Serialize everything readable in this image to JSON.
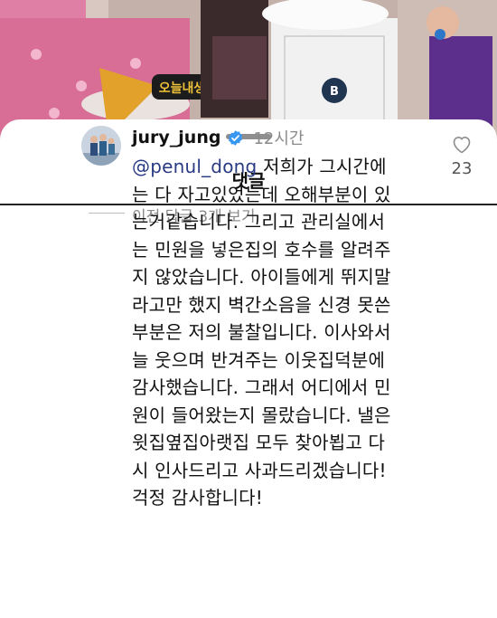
{
  "photo": {
    "sign_text": "오늘내생일",
    "box_logo": "B"
  },
  "sheet": {
    "title": "댓글",
    "view_replies": "이전 답글 3개 보기"
  },
  "comment": {
    "username": "jury_jung",
    "verified_icon": "verified-badge-icon",
    "timestamp": "12시간",
    "mention": "@penul_dong",
    "lines": [
      " 저희가 그시간에",
      "는 다 자고있었는데 오해부분이 있",
      "는거같습니다. 그리고 관리실에서",
      "는 민원을 넣은집의 호수를 알려주",
      "지 않았습니다. 아이들에게 뛰지말",
      "라고만 했지 벽간소음을 신경 못쓴",
      "부분은 저의 불찰입니다. 이사와서",
      "늘 웃으며 반겨주는 이웃집덕분에",
      "감사했습니다. 그래서 어디에서 민",
      "원이 들어왔는지 몰랐습니다. 낼은",
      "윗집옆집아랫집 모두 찾아뵙고 다",
      "시 인사드리고 사과드리겠습니다!",
      "걱정 감사합니다!"
    ],
    "like_icon": "heart-outline-icon",
    "like_count": "23"
  },
  "colors": {
    "mention": "#2a3a83",
    "verified": "#3897f0",
    "secondary_text": "#8a8a8a"
  }
}
